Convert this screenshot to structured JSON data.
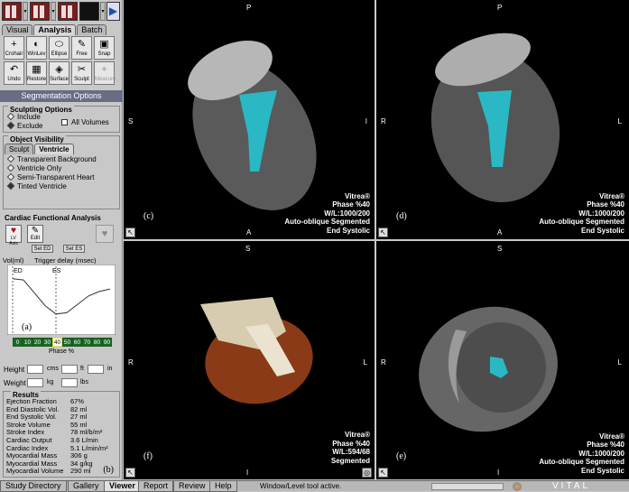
{
  "toolbar": {
    "caret": "▾",
    "play_icon": "▶"
  },
  "left_tabs": [
    "Visual",
    "Analysis",
    "Batch"
  ],
  "tools": [
    {
      "label": "Crohair",
      "icon": "+"
    },
    {
      "label": "WinLev",
      "icon": "◐"
    },
    {
      "label": "Ellipse",
      "icon": "⬭"
    },
    {
      "label": "Free",
      "icon": "✎"
    },
    {
      "label": "Snap",
      "icon": "▣"
    },
    {
      "label": "Undo",
      "icon": "↶"
    },
    {
      "label": "Restore",
      "icon": "▦"
    },
    {
      "label": "Surface",
      "icon": "◈"
    },
    {
      "label": "Sculpt",
      "icon": "✂"
    },
    {
      "label": "Measure",
      "icon": "⌖"
    }
  ],
  "segmentation_header": "Segmentation Options",
  "sculpting": {
    "title": "Sculpting Options",
    "include": "Include",
    "exclude": "Exclude",
    "all_volumes": "All Volumes"
  },
  "object_visibility": {
    "title": "Object Visibility",
    "tabs": [
      "Sculpt",
      "Ventricle"
    ],
    "options": [
      "Transparent Background",
      "Ventricle Only",
      "Semi-Transparent Heart",
      "Tinted Ventricle"
    ]
  },
  "cardiac": {
    "title": "Cardiac Functional Analysis",
    "btn_axis": "LV Axis",
    "btn_edit": "Edit",
    "set_ed": "Set ED",
    "set_es": "Set ES",
    "vol_label": "Vol(ml)",
    "trigger_label": "Trigger delay (msec)",
    "ed": "ED",
    "es": "ES",
    "panel_letter": "(a)",
    "phases": [
      "0",
      "10",
      "20",
      "30",
      "40",
      "50",
      "60",
      "70",
      "80",
      "90"
    ],
    "selected_phase": "40",
    "phase_label": "Phase %"
  },
  "chart_data": {
    "type": "line",
    "x": [
      0,
      10,
      20,
      30,
      40,
      50,
      60,
      70,
      80,
      90
    ],
    "y": [
      82,
      80,
      60,
      40,
      27,
      29,
      42,
      55,
      62,
      66
    ]
  },
  "patient": {
    "height_label": "Height",
    "cms": "cms",
    "ft": "ft",
    "in": "in",
    "weight_label": "Weight",
    "kg": "kg",
    "lbs": "lbs"
  },
  "results": {
    "title": "Results",
    "rows": [
      {
        "k": "Ejection Fraction",
        "v": "67%"
      },
      {
        "k": "End Diastolic Vol.",
        "v": "82 ml"
      },
      {
        "k": "End Systolic Vol.",
        "v": "27 ml"
      },
      {
        "k": "Stroke Volume",
        "v": "55 ml"
      },
      {
        "k": "Stroke Index",
        "v": "78 ml/b/m²"
      },
      {
        "k": "Cardiac Output",
        "v": "3.6 L/min"
      },
      {
        "k": "Cardiac Index",
        "v": "5.1 L/min/m²"
      },
      {
        "k": "Myocardial Mass",
        "v": "306 g"
      },
      {
        "k": "Myocardial Mass",
        "v": "34 g/kg"
      },
      {
        "k": "Myocardial Volume",
        "v": "290 ml"
      }
    ],
    "panel_letter": "(b)"
  },
  "viewports": {
    "c": {
      "top": "P",
      "left": "S",
      "right": "I",
      "bottom": "A",
      "letter": "(c)",
      "info": [
        "Vitrea®",
        "Phase %40",
        "W/L:1000/200",
        "Auto-oblique Segmented",
        "End Systolic"
      ]
    },
    "d": {
      "top": "P",
      "left": "R",
      "right": "L",
      "bottom": "A",
      "letter": "(d)",
      "info": [
        "Vitrea®",
        "Phase %40",
        "W/L:1000/200",
        "Auto-oblique Segmented",
        "End Systolic"
      ]
    },
    "f": {
      "top": "S",
      "left": "R",
      "right": "L",
      "bottom": "I",
      "letter": "(f)",
      "info": [
        "Vitrea®",
        "Phase %40",
        "W/L:594/68",
        "Segmented"
      ]
    },
    "e": {
      "top": "S",
      "left": "R",
      "right": "L",
      "bottom": "I",
      "letter": "(e)",
      "info": [
        "Vitrea®",
        "Phase %40",
        "W/L:1000/200",
        "Auto-oblique Segmented",
        "End Systolic"
      ]
    }
  },
  "bottom_tabs": [
    "Study Directory",
    "Gallery",
    "Viewer",
    "Report",
    "Review",
    "Help"
  ],
  "status": "Window/Level tool active.",
  "brand": "VITAL"
}
